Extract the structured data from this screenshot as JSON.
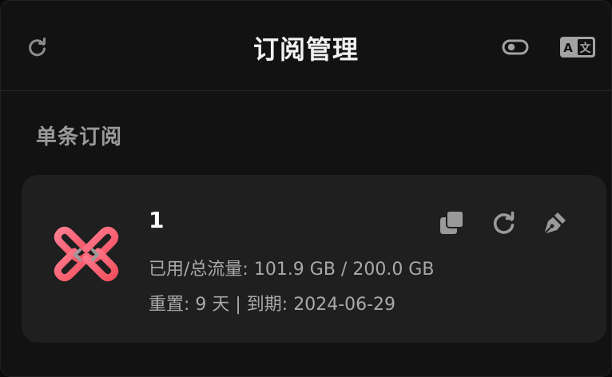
{
  "header": {
    "title": "订阅管理",
    "refresh_icon": "refresh-icon",
    "toggle_icon": "toggle-icon",
    "translate_icon": "translate-icon",
    "translate_glyph_a": "A",
    "translate_glyph_b": "文"
  },
  "section": {
    "title": "单条订阅"
  },
  "subscription": {
    "name": "1",
    "usage_text": "已用/总流量: 101.9 GB / 200.0 GB",
    "reset_text": "重置: 9 天 | 到期: 2024-06-29",
    "actions": [
      "copy-icon",
      "refresh-icon",
      "edit-icon"
    ]
  },
  "colors": {
    "background": "#121212",
    "card": "#1f1f1f",
    "logo_gradient_start": "#ff6d8a",
    "logo_gradient_end": "#f5524f",
    "icon_gray": "#9a9a9a"
  }
}
